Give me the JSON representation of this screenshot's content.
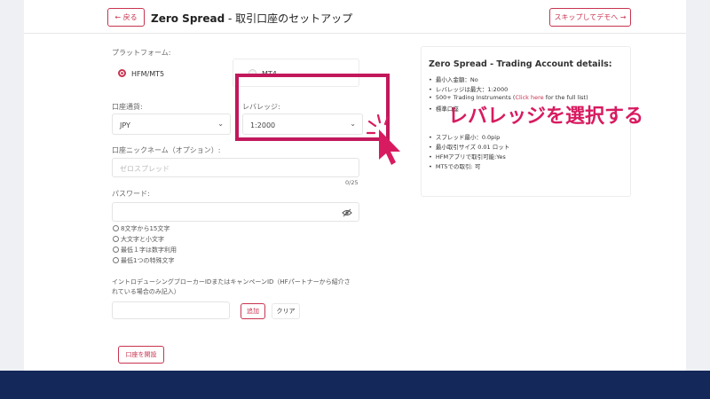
{
  "header": {
    "back_label": "← 戻る",
    "title_bold": "Zero Spread",
    "title_rest": " - 取引口座のセットアップ",
    "skip_label": "スキップしてデモへ →"
  },
  "platform": {
    "label": "プラットフォーム:",
    "options": [
      {
        "label": "HFM/MT5",
        "selected": true
      },
      {
        "label": "MT4",
        "selected": false
      }
    ]
  },
  "currency": {
    "label": "口座通貨:",
    "value": "JPY"
  },
  "leverage": {
    "label": "レバレッジ:",
    "value": "1:2000"
  },
  "nickname": {
    "label": "口座ニックネーム（オプション）:",
    "placeholder": "ゼロスプレッド",
    "counter": "0/25"
  },
  "password": {
    "label": "パスワード:",
    "rules": [
      "8文字から15文字",
      "大文字と小文字",
      "最低１字は数字利用",
      "最低1つの特殊文字"
    ]
  },
  "ib": {
    "label_line1": "イントロデューシングブローカーIDまたはキャンペーンID（HFパートナーから紹介さ",
    "label_line2": "れている場合のみ記入）",
    "add_label": "追加",
    "clear_label": "クリア"
  },
  "open_account_label": "口座を開設",
  "details": {
    "title": "Zero Spread - Trading Account details:",
    "items": [
      {
        "text": "最小入金額：No"
      },
      {
        "text": "レバレッジは最大：1:2000"
      },
      {
        "pre": "500+ Trading Instruments (",
        "link": "Click here",
        "post": " for the full list)"
      },
      {
        "text": "標準口座"
      },
      {
        "text": "スプレッド最小：0.0pip"
      },
      {
        "text": "最小取引サイズ 0.01 ロット"
      },
      {
        "text": "HFMアプリで取引可能:Yes"
      },
      {
        "text": "MT5での取引: 可"
      }
    ]
  },
  "annotation": {
    "text": "レバレッジを選択する"
  },
  "colors": {
    "accent": "#c8334f",
    "highlight": "#c2185b",
    "footer": "#14285a"
  },
  "icons": {
    "back": "arrow-left-icon",
    "skip": "arrow-right-icon",
    "eye": "eye-off-icon",
    "cursor": "hand-pointer-icon"
  }
}
